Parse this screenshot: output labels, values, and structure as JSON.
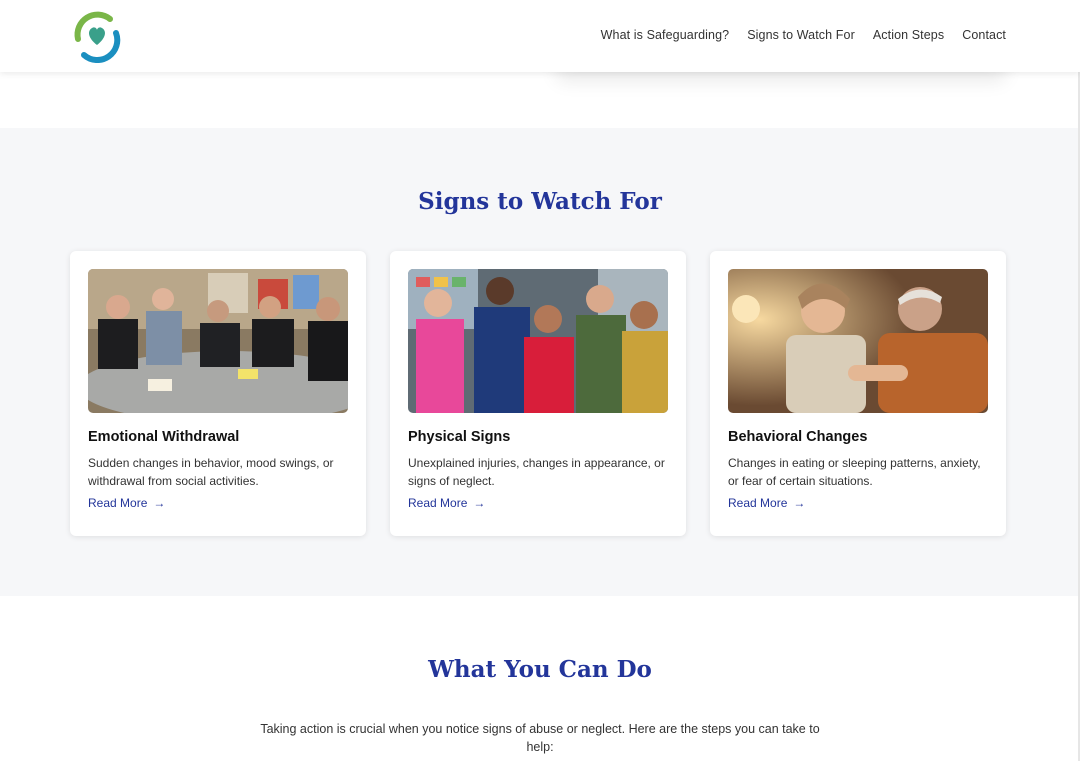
{
  "header": {
    "nav": [
      {
        "label": "What is Safeguarding?"
      },
      {
        "label": "Signs to Watch For"
      },
      {
        "label": "Action Steps"
      },
      {
        "label": "Contact"
      }
    ]
  },
  "signs": {
    "title": "Signs to Watch For",
    "cards": [
      {
        "title": "Emotional Withdrawal",
        "text": "Sudden changes in behavior, mood swings, or withdrawal from social activities.",
        "link": "Read More"
      },
      {
        "title": "Physical Signs",
        "text": "Unexplained injuries, changes in appearance, or signs of neglect.",
        "link": "Read More"
      },
      {
        "title": "Behavioral Changes",
        "text": "Changes in eating or sleeping patterns, anxiety, or fear of certain situations.",
        "link": "Read More"
      }
    ]
  },
  "action": {
    "title": "What You Can Do",
    "intro": "Taking action is crucial when you notice signs of abuse or neglect. Here are the steps you can take to help:"
  },
  "colors": {
    "accent": "#23359a",
    "section_bg": "#f6f7f9",
    "logo_green": "#7ab648",
    "logo_blue": "#1b8fc0"
  },
  "icons": [
    "logo-icon",
    "arrow-right-icon"
  ]
}
